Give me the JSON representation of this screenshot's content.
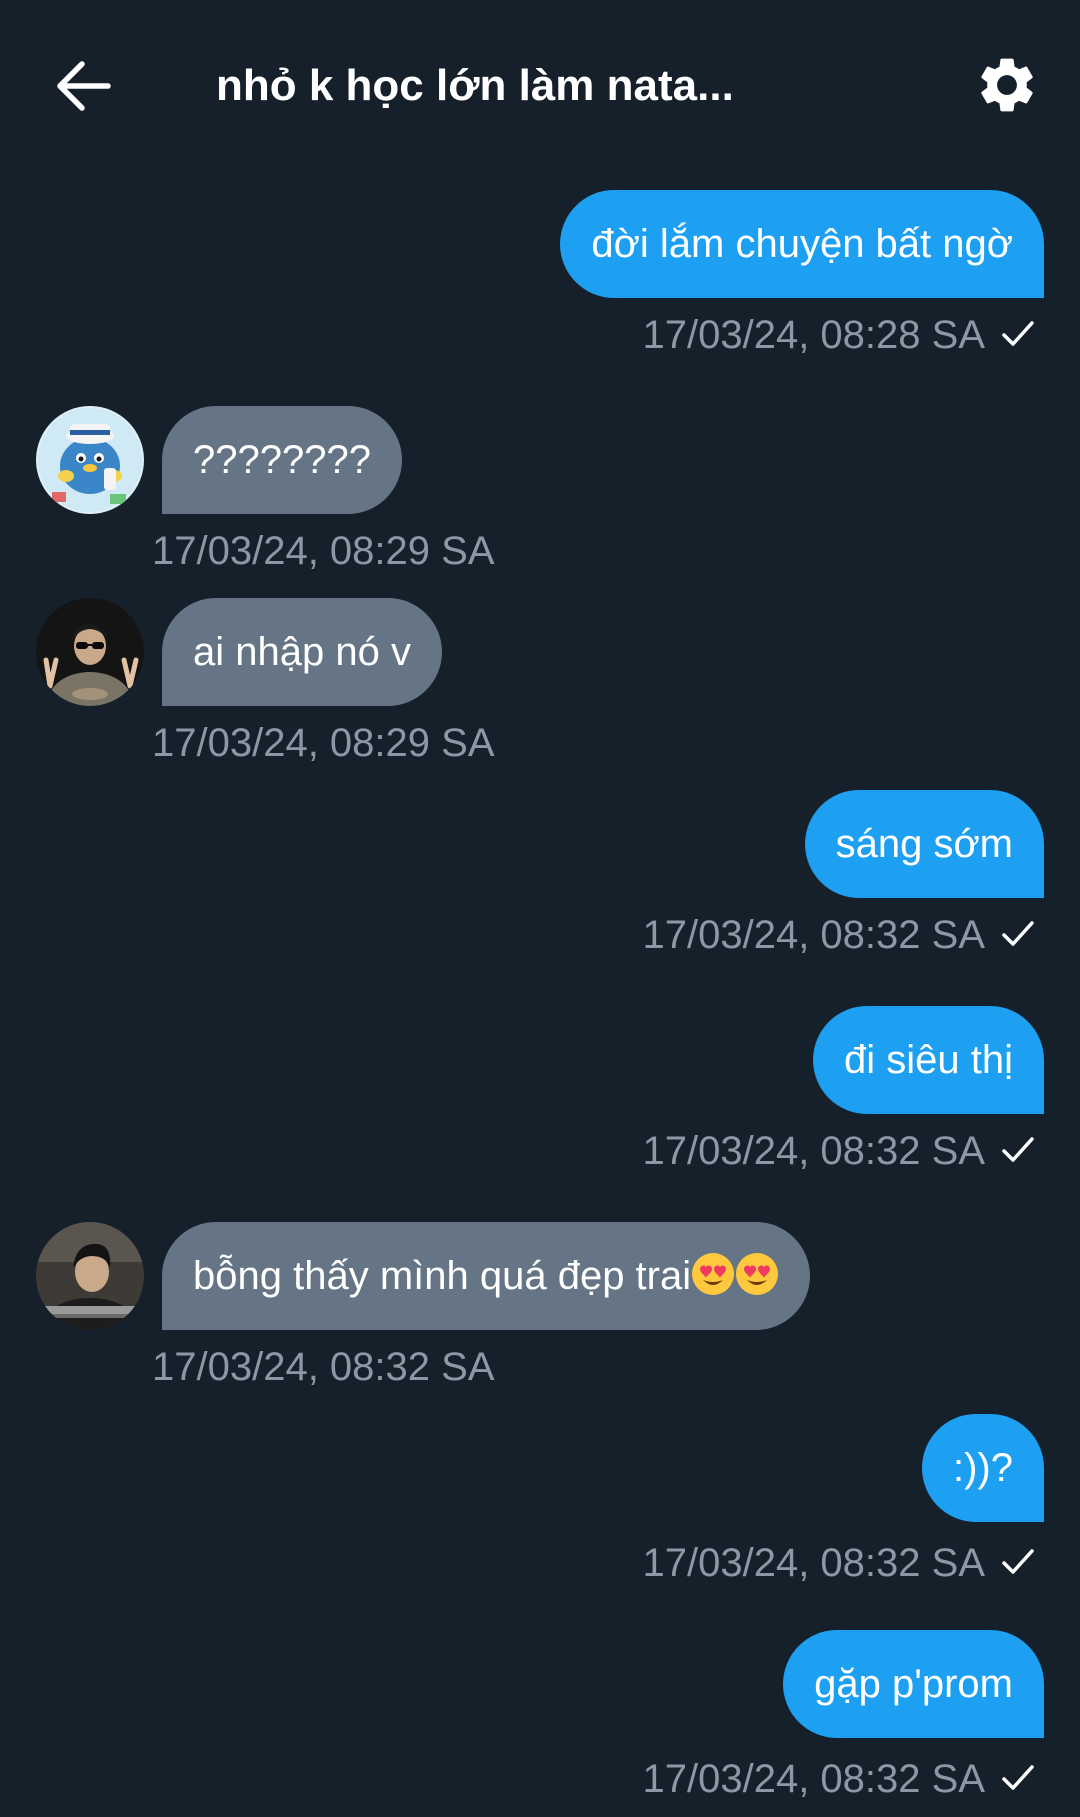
{
  "header": {
    "title": "nhỏ k học lớn làm nata..."
  },
  "messages": [
    {
      "direction": "out",
      "text": "đời lắm chuyện bất ngờ",
      "time": "17/03/24, 08:28 SA",
      "read": true
    },
    {
      "direction": "in",
      "avatar": "blue-penguin-avatar",
      "text": "????????",
      "time": "17/03/24, 08:29 SA"
    },
    {
      "direction": "in",
      "avatar": "sunglasses-boy-avatar",
      "text": "ai nhập nó v",
      "time": "17/03/24, 08:29 SA"
    },
    {
      "direction": "out",
      "text": "sáng sớm",
      "time": "17/03/24, 08:32 SA",
      "read": true
    },
    {
      "direction": "out",
      "text": "đi siêu thị",
      "time": "17/03/24, 08:32 SA",
      "read": true
    },
    {
      "direction": "in",
      "avatar": "dark-hair-boy-avatar",
      "text": "bỗng thấy mình quá đẹp trai",
      "emojis": [
        "heart-eyes-emoji",
        "heart-eyes-emoji"
      ],
      "time": "17/03/24, 08:32 SA"
    },
    {
      "direction": "out",
      "text": ":))?",
      "time": "17/03/24, 08:32 SA",
      "read": true
    },
    {
      "direction": "out",
      "text": "gặp p'prom",
      "time": "17/03/24, 08:32 SA",
      "read": true
    }
  ],
  "colors": {
    "background": "#16202b",
    "outgoing_bubble": "#1da0f1",
    "incoming_bubble": "#657585",
    "timestamp": "#8b98a5"
  }
}
